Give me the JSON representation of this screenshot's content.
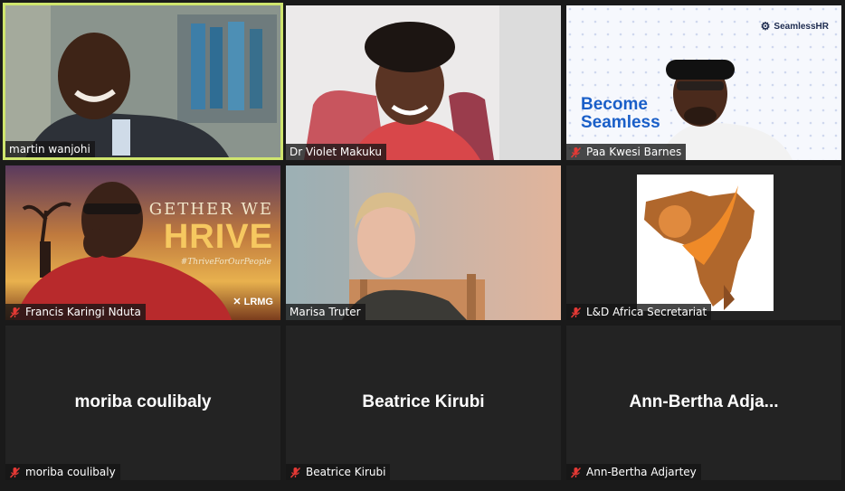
{
  "participants": [
    {
      "name": "martin wanjohi",
      "muted": false,
      "video": true,
      "active": true
    },
    {
      "name": "Dr Violet Makuku",
      "muted": false,
      "video": true,
      "active": false
    },
    {
      "name": "Paa Kwesi Barnes",
      "muted": true,
      "video": true,
      "active": false
    },
    {
      "name": "Francis Karingi Nduta",
      "muted": true,
      "video": true,
      "active": false
    },
    {
      "name": "Marisa Truter",
      "muted": false,
      "video": true,
      "active": false
    },
    {
      "name": "L&D Africa Secretariat",
      "muted": true,
      "video": true,
      "active": false
    },
    {
      "name": "moriba coulibaly",
      "display_name": "moriba coulibaly",
      "muted": true,
      "video": false,
      "active": false
    },
    {
      "name": "Beatrice Kirubi",
      "display_name": "Beatrice Kirubi",
      "muted": true,
      "video": false,
      "active": false
    },
    {
      "name": "Ann-Bertha Adjartey",
      "display_name": "Ann-Bertha  Adja...",
      "muted": true,
      "video": false,
      "active": false
    }
  ],
  "backgrounds": {
    "seamless_logo": "SeamlessHR",
    "seamless_line1": "Become",
    "seamless_line2": "Seamless",
    "banner_top": "GETHER WE",
    "banner_big": "HRIVE",
    "banner_tag": "#ThriveForOurPeople",
    "banner_logo": "LRMG"
  },
  "colors": {
    "active_border": "#cfe56e",
    "muted_icon": "#e53935",
    "tile_bg": "#232323",
    "app_bg": "#1a1a1a"
  },
  "icons": {
    "muted": "mic-muted-icon"
  }
}
